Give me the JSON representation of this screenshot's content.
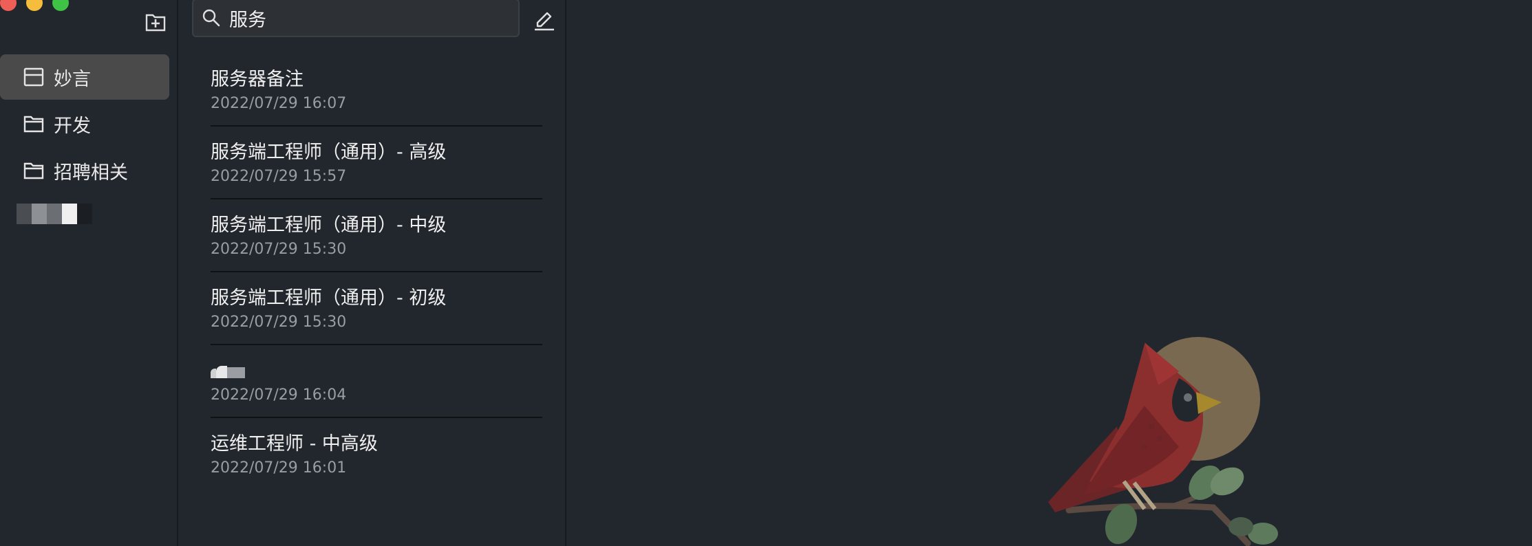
{
  "window": {
    "controls": [
      "close",
      "minimize",
      "zoom"
    ]
  },
  "sidebar": {
    "new_folder_icon": "folder-plus-icon",
    "items": [
      {
        "label": "妙言",
        "icon": "inbox-icon",
        "active": true
      },
      {
        "label": "开发",
        "icon": "folder-icon",
        "active": false
      },
      {
        "label": "招聘相关",
        "icon": "folder-icon",
        "active": false
      }
    ]
  },
  "search": {
    "value": "服务",
    "icon": "search-icon"
  },
  "toolbar": {
    "compose_icon": "pencil-icon"
  },
  "notes": [
    {
      "title": "服务器备注",
      "date": "2022/07/29 16:07"
    },
    {
      "title": "服务端工程师（通用）- 高级",
      "date": "2022/07/29 15:57"
    },
    {
      "title": "服务端工程师（通用）- 中级",
      "date": "2022/07/29 15:30"
    },
    {
      "title": "服务端工程师（通用）- 初级",
      "date": "2022/07/29 15:30"
    },
    {
      "title": "",
      "date": "2022/07/29 16:04"
    },
    {
      "title": "运维工程师 - 中高级",
      "date": "2022/07/29 16:01"
    }
  ],
  "colors": {
    "background": "#22272d",
    "active_item": "#4a4a4a",
    "cardinal_red": "#8b2e2e",
    "moon": "#8a7658",
    "leaf": "#5b7a5a"
  },
  "illustration": "cardinal-bird-illustration"
}
